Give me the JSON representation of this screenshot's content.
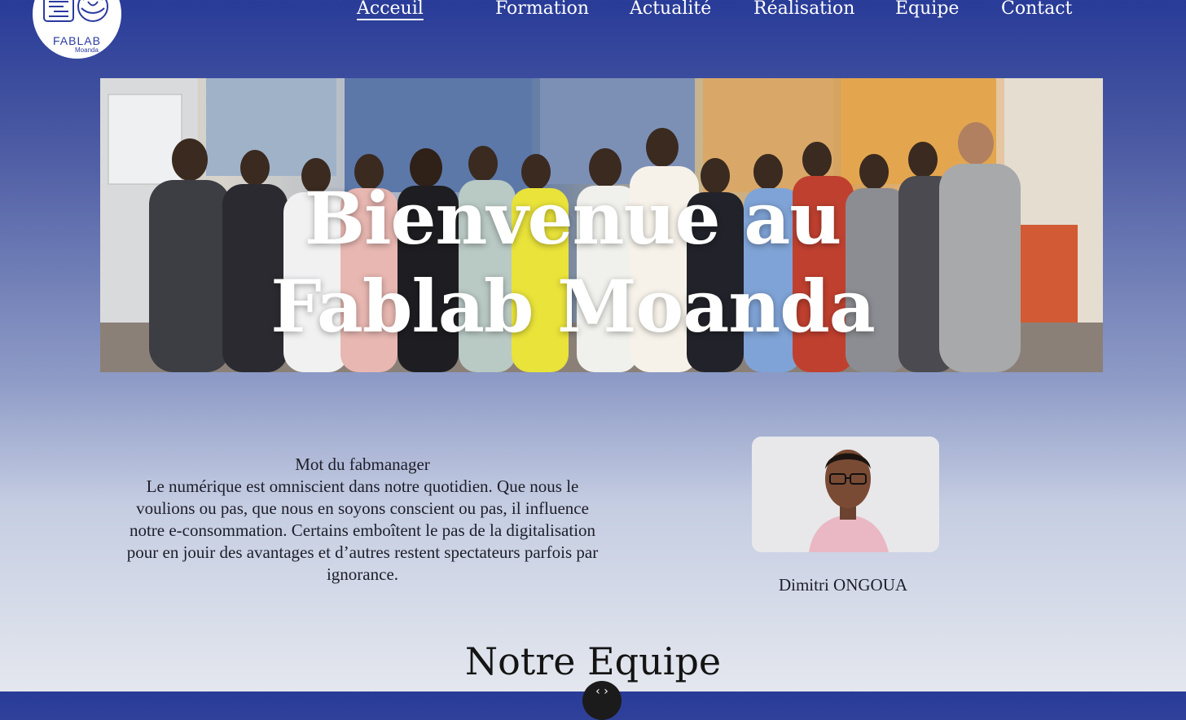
{
  "logo": {
    "text": "FABLAB",
    "sub": "Moanda",
    "color": "#2a3aa0"
  },
  "nav": {
    "items": [
      {
        "label": "Acceuil",
        "active": true
      },
      {
        "label": "Formation",
        "active": false
      },
      {
        "label": "Actualité",
        "active": false
      },
      {
        "label": "Réalisation",
        "active": false
      },
      {
        "label": "Equipe",
        "active": false
      },
      {
        "label": "Contact",
        "active": false
      }
    ]
  },
  "hero": {
    "title_line1": "Bienvenue au",
    "title_line2": "Fablab Moanda",
    "image": "group-photo"
  },
  "manager": {
    "heading": "Mot du fabmanager",
    "paragraph": "Le numérique est omniscient dans notre quotidien. Que nous le voulions ou pas, que nous en soyons conscient ou pas, il influence notre e-consommation. Certains emboîtent le pas de la digitalisation pour en jouir des avantages et d’autres restent spectateurs parfois par ignorance.",
    "name": "Dimitri ONGOUA",
    "image": "portrait-photo"
  },
  "team": {
    "title": "Notre Equipe"
  },
  "scroll_button": {
    "icon": "code-icon",
    "glyph": "‹ ›"
  },
  "colors": {
    "primary": "#283b98",
    "text": "#1e1e2a",
    "white": "#ffffff"
  }
}
